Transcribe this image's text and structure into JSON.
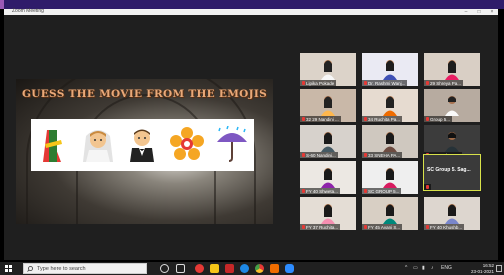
{
  "window": {
    "title": "Zoom Meeting"
  },
  "slide": {
    "title": "GUESS THE MOVIE FROM THE EMOJIS",
    "emojis": [
      "dress-icon",
      "bride-icon",
      "groom-icon",
      "flower-icon",
      "umbrella-rain-icon"
    ]
  },
  "participants": [
    {
      "name": "Lipika Pokade",
      "mic": "muted"
    },
    {
      "name": "Dr. Rashmi Wanj...",
      "mic": "muted"
    },
    {
      "name": "29 Shreya Pa...",
      "mic": "muted"
    },
    {
      "name": "32 29 Nandini ...",
      "mic": "muted"
    },
    {
      "name": "34 Ruchita Pa...",
      "mic": "muted"
    },
    {
      "name": "Group 5...",
      "mic": "muted"
    },
    {
      "name": "S-60 Nandini...",
      "mic": "muted"
    },
    {
      "name": "33 SNEHA PA...",
      "mic": "muted"
    },
    {
      "name": "29 Harsh Mo...",
      "mic": "muted"
    },
    {
      "name": "FY 40 Shweta...",
      "mic": "muted"
    },
    {
      "name": "SC GROUP 5...",
      "mic": "muted"
    },
    {
      "name": "SC Group 5. Sag...",
      "mic": "muted"
    },
    {
      "name": "FY 37 Ruchita...",
      "mic": "muted"
    },
    {
      "name": "FY 45 Avani S...",
      "mic": "muted"
    },
    {
      "name": "FY 40 Khushb...",
      "mic": "muted"
    }
  ],
  "taskbar": {
    "search_placeholder": "Type here to search",
    "tray_lang": "ENG",
    "time": "16:52",
    "date": "23-01-2021"
  },
  "colors": {
    "title_orange": "#e9a979",
    "active_speaker": "#d8e24a",
    "taskbar": "#202020"
  }
}
